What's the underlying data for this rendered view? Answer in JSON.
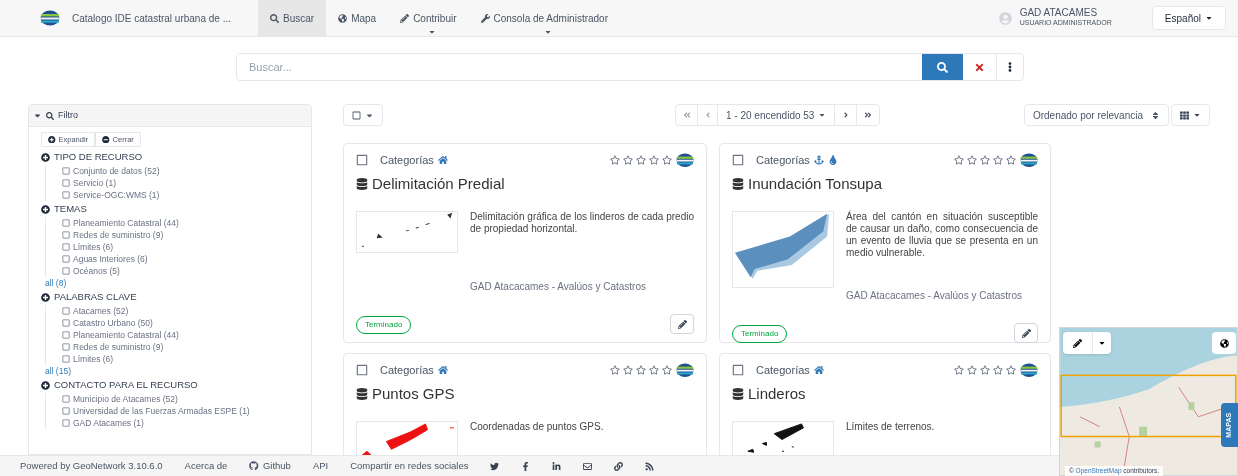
{
  "nav": {
    "title": "Catalogo IDE catastral urbana de ...",
    "items": [
      {
        "label": "Buscar",
        "kind": "search",
        "selected": true,
        "dropdown": false
      },
      {
        "label": "Mapa",
        "kind": "globe",
        "selected": false,
        "dropdown": false
      },
      {
        "label": "Contribuir",
        "kind": "pencil",
        "selected": false,
        "dropdown": true
      },
      {
        "label": "Consola de Administrador",
        "kind": "wrench",
        "selected": false,
        "dropdown": true
      }
    ],
    "user": {
      "name": "GAD ATACAMES",
      "role": "USUARIO ADMINISTRADOR"
    },
    "language": "Español"
  },
  "search": {
    "placeholder": "Buscar..."
  },
  "filter": {
    "title": "Filtro",
    "expanded": true,
    "buttons": [
      {
        "label": "Expandir",
        "kind": "expand"
      },
      {
        "label": "Cerrar",
        "kind": "collapse"
      }
    ],
    "groups": [
      {
        "title": "TIPO DE RECURSO",
        "items": [
          {
            "label": "Conjunto de datos (52)",
            "checked": false
          },
          {
            "label": "Servicio (1)",
            "checked": false
          },
          {
            "label": "Service-OGC:WMS (1)",
            "checked": false
          }
        ]
      },
      {
        "title": "TEMAS",
        "items": [
          {
            "label": "Planeamiento Catastral (44)",
            "checked": false
          },
          {
            "label": "Redes de suministro (9)",
            "checked": false
          },
          {
            "label": "Límites (6)",
            "checked": false
          },
          {
            "label": "Aguas Interiores (6)",
            "checked": false
          },
          {
            "label": "Océanos (5)",
            "checked": false
          }
        ],
        "more": "all (8)"
      },
      {
        "title": "PALABRAS CLAVE",
        "items": [
          {
            "label": "Atacames (52)",
            "checked": false
          },
          {
            "label": "Catastro Urbano (50)",
            "checked": false
          },
          {
            "label": "Planeamiento Catastral (44)",
            "checked": false
          },
          {
            "label": "Redes de suministro (9)",
            "checked": false
          },
          {
            "label": "Límites (6)",
            "checked": false
          }
        ],
        "more": "all (15)"
      },
      {
        "title": "CONTACTO PARA EL RECURSO",
        "items": [
          {
            "label": "Municipio de Atacames (52)",
            "checked": false
          },
          {
            "label": "Universidad de las Fuerzas Armadas ESPE (1)",
            "checked": false
          },
          {
            "label": "GAD Atacames (1)",
            "checked": false
          }
        ]
      }
    ]
  },
  "toolbar": {
    "select_all": {
      "checked": false
    },
    "pagination": "1 - 20 encendido 53",
    "sort": "Ordenado por relevancia"
  },
  "records": [
    {
      "selected": false,
      "category": "Categorías",
      "category_icons": [
        {
          "kind": "home"
        }
      ],
      "stars": 0,
      "title": "Delimitación Predial",
      "thumbnail": {
        "kind": "points"
      },
      "description": "Delimitación gráfica de los linderos de cada predio de propiedad horizontal.",
      "contact": "GAD Atacacames - Avalúos y Catastros",
      "status": "Terminado"
    },
    {
      "selected": false,
      "category": "Categorías",
      "category_icons": [
        {
          "kind": "anchor"
        },
        {
          "kind": "drop"
        }
      ],
      "stars": 0,
      "title": "Inundación Tonsupa",
      "thumbnail": {
        "kind": "flood"
      },
      "description": "Área del cantón en situación susceptible de causar un daño, como consecuencia de un evento de lluvia que se presenta en un medio vulnerable.",
      "contact": "GAD Atacacames - Avalúos y Catastros",
      "status": "Terminado"
    },
    {
      "selected": false,
      "category": "Categorías",
      "category_icons": [
        {
          "kind": "home"
        }
      ],
      "stars": 0,
      "title": "Puntos GPS",
      "thumbnail": {
        "kind": "red"
      },
      "description": "Coordenadas de puntos GPS."
    },
    {
      "selected": false,
      "category": "Categorías",
      "category_icons": [
        {
          "kind": "home"
        }
      ],
      "stars": 0,
      "title": "Linderos",
      "thumbnail": {
        "kind": "black"
      },
      "description": "Límites de terrenos."
    }
  ],
  "map": {
    "attribution_prefix": "©",
    "attribution_link": "OpenStreetMap",
    "attribution_text": "contributors.",
    "tab": "MAPAS"
  },
  "footer": {
    "powered": "Powered by GeoNetwork 3.10.6.0",
    "links": [
      {
        "label": "Acerca de",
        "kind": "text"
      },
      {
        "label": "Github",
        "kind": "github"
      },
      {
        "label": "API",
        "kind": "text"
      }
    ],
    "share": "Compartir en redes sociales",
    "social": [
      {
        "kind": "twitter"
      },
      {
        "kind": "facebook"
      },
      {
        "kind": "linkedin"
      },
      {
        "kind": "email"
      },
      {
        "kind": "link"
      },
      {
        "kind": "rss"
      }
    ]
  }
}
